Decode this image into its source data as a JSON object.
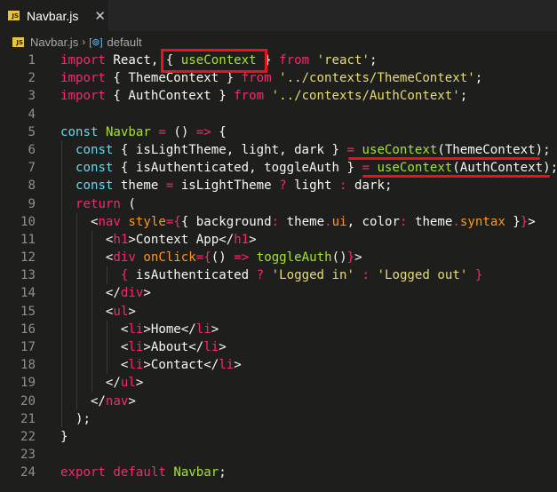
{
  "tab": {
    "icon": "JS",
    "label": "Navbar.js",
    "close": "✕"
  },
  "breadcrumb": {
    "file": "Navbar.js",
    "separator": "›",
    "symbol": "default"
  },
  "colors": {
    "keyword": "#f92672",
    "storage": "#66d9ef",
    "function": "#a6e22e",
    "string": "#e6db74",
    "attribute": "#fd971f",
    "annotation": "#e8141c"
  },
  "lines": [
    {
      "n": "1",
      "t": [
        [
          "kw",
          "import"
        ],
        [
          "tx",
          " React, { "
        ],
        [
          "fn",
          "useContext"
        ],
        [
          "tx",
          " } "
        ],
        [
          "kw",
          "from"
        ],
        [
          "tx",
          " "
        ],
        [
          "str",
          "'react'"
        ],
        [
          "tx",
          ";"
        ]
      ]
    },
    {
      "n": "2",
      "t": [
        [
          "kw",
          "import"
        ],
        [
          "tx",
          " { ThemeContext } "
        ],
        [
          "kw",
          "from"
        ],
        [
          "tx",
          " "
        ],
        [
          "str",
          "'../contexts/ThemeContext'"
        ],
        [
          "tx",
          ";"
        ]
      ]
    },
    {
      "n": "3",
      "t": [
        [
          "kw",
          "import"
        ],
        [
          "tx",
          " { AuthContext } "
        ],
        [
          "kw",
          "from"
        ],
        [
          "tx",
          " "
        ],
        [
          "str",
          "'../contexts/AuthContext'"
        ],
        [
          "tx",
          ";"
        ]
      ]
    },
    {
      "n": "4",
      "t": []
    },
    {
      "n": "5",
      "t": [
        [
          "st",
          "const"
        ],
        [
          "tx",
          " "
        ],
        [
          "fn",
          "Navbar"
        ],
        [
          "tx",
          " "
        ],
        [
          "kw",
          "="
        ],
        [
          "tx",
          " () "
        ],
        [
          "kw",
          "=>"
        ],
        [
          "tx",
          " {"
        ]
      ]
    },
    {
      "n": "6",
      "t": [
        [
          "tx",
          "  "
        ],
        [
          "st",
          "const"
        ],
        [
          "tx",
          " { isLightTheme, light, dark } "
        ],
        [
          "kw",
          "="
        ],
        [
          "tx",
          " "
        ],
        [
          "fn",
          "useContext"
        ],
        [
          "tx",
          "(ThemeContext);"
        ]
      ]
    },
    {
      "n": "7",
      "t": [
        [
          "tx",
          "  "
        ],
        [
          "st",
          "const"
        ],
        [
          "tx",
          " { isAuthenticated, toggleAuth } "
        ],
        [
          "kw",
          "="
        ],
        [
          "tx",
          " "
        ],
        [
          "fn",
          "useContext"
        ],
        [
          "tx",
          "(AuthContext);"
        ]
      ]
    },
    {
      "n": "8",
      "t": [
        [
          "tx",
          "  "
        ],
        [
          "st",
          "const"
        ],
        [
          "tx",
          " theme "
        ],
        [
          "kw",
          "="
        ],
        [
          "tx",
          " isLightTheme "
        ],
        [
          "kw",
          "?"
        ],
        [
          "tx",
          " light "
        ],
        [
          "kw",
          ":"
        ],
        [
          "tx",
          " dark;"
        ]
      ]
    },
    {
      "n": "9",
      "t": [
        [
          "tx",
          "  "
        ],
        [
          "kw",
          "return"
        ],
        [
          "tx",
          " ("
        ]
      ]
    },
    {
      "n": "10",
      "t": [
        [
          "tx",
          "    <"
        ],
        [
          "kw",
          "nav"
        ],
        [
          "tx",
          " "
        ],
        [
          "at",
          "style"
        ],
        [
          "kw",
          "={"
        ],
        [
          "tx",
          "{ background"
        ],
        [
          "kw",
          ":"
        ],
        [
          "tx",
          " theme"
        ],
        [
          "kw",
          "."
        ],
        [
          "at",
          "ui"
        ],
        [
          "tx",
          ", color"
        ],
        [
          "kw",
          ":"
        ],
        [
          "tx",
          " theme"
        ],
        [
          "kw",
          "."
        ],
        [
          "at",
          "syntax"
        ],
        [
          "tx",
          " }"
        ],
        [
          "kw",
          "}"
        ],
        [
          "tx",
          ">"
        ]
      ]
    },
    {
      "n": "11",
      "t": [
        [
          "tx",
          "      <"
        ],
        [
          "kw",
          "h1"
        ],
        [
          "tx",
          ">Context App</"
        ],
        [
          "kw",
          "h1"
        ],
        [
          "tx",
          ">"
        ]
      ]
    },
    {
      "n": "12",
      "t": [
        [
          "tx",
          "      <"
        ],
        [
          "kw",
          "div"
        ],
        [
          "tx",
          " "
        ],
        [
          "at",
          "onClick"
        ],
        [
          "kw",
          "={"
        ],
        [
          "tx",
          "() "
        ],
        [
          "kw",
          "=>"
        ],
        [
          "tx",
          " "
        ],
        [
          "fn",
          "toggleAuth"
        ],
        [
          "tx",
          "()"
        ],
        [
          "kw",
          "}"
        ],
        [
          "tx",
          ">"
        ]
      ]
    },
    {
      "n": "13",
      "t": [
        [
          "tx",
          "        "
        ],
        [
          "kw",
          "{"
        ],
        [
          "tx",
          " isAuthenticated "
        ],
        [
          "kw",
          "?"
        ],
        [
          "tx",
          " "
        ],
        [
          "str",
          "'Logged in'"
        ],
        [
          "tx",
          " "
        ],
        [
          "kw",
          ":"
        ],
        [
          "tx",
          " "
        ],
        [
          "str",
          "'Logged out'"
        ],
        [
          "tx",
          " "
        ],
        [
          "kw",
          "}"
        ]
      ]
    },
    {
      "n": "14",
      "t": [
        [
          "tx",
          "      </"
        ],
        [
          "kw",
          "div"
        ],
        [
          "tx",
          ">"
        ]
      ]
    },
    {
      "n": "15",
      "t": [
        [
          "tx",
          "      <"
        ],
        [
          "kw",
          "ul"
        ],
        [
          "tx",
          ">"
        ]
      ]
    },
    {
      "n": "16",
      "t": [
        [
          "tx",
          "        <"
        ],
        [
          "kw",
          "li"
        ],
        [
          "tx",
          ">Home</"
        ],
        [
          "kw",
          "li"
        ],
        [
          "tx",
          ">"
        ]
      ]
    },
    {
      "n": "17",
      "t": [
        [
          "tx",
          "        <"
        ],
        [
          "kw",
          "li"
        ],
        [
          "tx",
          ">About</"
        ],
        [
          "kw",
          "li"
        ],
        [
          "tx",
          ">"
        ]
      ]
    },
    {
      "n": "18",
      "t": [
        [
          "tx",
          "        <"
        ],
        [
          "kw",
          "li"
        ],
        [
          "tx",
          ">Contact</"
        ],
        [
          "kw",
          "li"
        ],
        [
          "tx",
          ">"
        ]
      ]
    },
    {
      "n": "19",
      "t": [
        [
          "tx",
          "      </"
        ],
        [
          "kw",
          "ul"
        ],
        [
          "tx",
          ">"
        ]
      ]
    },
    {
      "n": "20",
      "t": [
        [
          "tx",
          "    </"
        ],
        [
          "kw",
          "nav"
        ],
        [
          "tx",
          ">"
        ]
      ]
    },
    {
      "n": "21",
      "t": [
        [
          "tx",
          "  );"
        ]
      ]
    },
    {
      "n": "22",
      "t": [
        [
          "tx",
          "}"
        ]
      ]
    },
    {
      "n": "23",
      "t": []
    },
    {
      "n": "24",
      "t": [
        [
          "kw",
          "export"
        ],
        [
          "tx",
          " "
        ],
        [
          "kw",
          "default"
        ],
        [
          "tx",
          " "
        ],
        [
          "fn",
          "Navbar"
        ],
        [
          "tx",
          ";"
        ]
      ]
    }
  ]
}
